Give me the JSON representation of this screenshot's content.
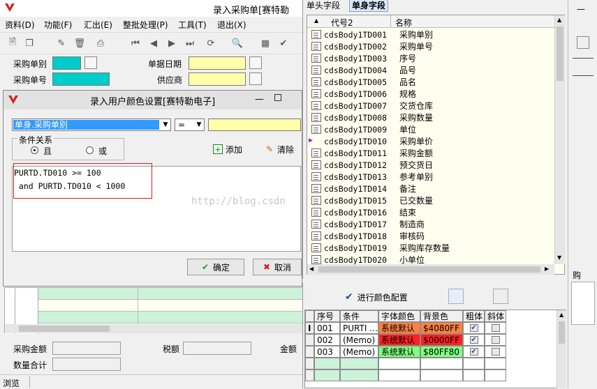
{
  "main_window": {
    "title": "录入采购单[赛特勒",
    "menu": [
      "资料(D)",
      "功能(F)",
      "汇出(E)",
      "整批处理(P)",
      "工具(T)",
      "退出(X)"
    ],
    "fields": {
      "po_type_label": "采购单别",
      "po_no_label": "采购单号",
      "doc_date_label": "单据日期",
      "supplier_label": "供应商",
      "po_amount_label": "采购金额",
      "tax_label": "税额",
      "amount_label": "金额",
      "qty_total_label": "数量合计"
    },
    "status": "浏览",
    "right_partial_label": "购"
  },
  "dialog": {
    "title": "录入用户颜色设置[赛特勒电子]",
    "field_select": "单身.采购单别",
    "operator": "=",
    "cond_group_label": "条件关系",
    "radio_and": "且",
    "radio_or": "或",
    "add_label": "添加",
    "clear_label": "清除",
    "expr_line1": "PURTD.TD010 >= 100",
    "expr_line2": " and PURTD.TD010 < 1000",
    "ok_label": "确定",
    "cancel_label": "取消",
    "watermark": "http://blog.csdn"
  },
  "field_panel": {
    "tab_header": "单头字段",
    "tab_body": "单身字段",
    "col_code": "代号2",
    "col_name": "名称",
    "rows": [
      {
        "code": "cdsBody1TD001",
        "name": "采购单别"
      },
      {
        "code": "cdsBody1TD002",
        "name": "采购单号"
      },
      {
        "code": "cdsBody1TD003",
        "name": "序号"
      },
      {
        "code": "cdsBody1TD004",
        "name": "品号"
      },
      {
        "code": "cdsBody1TD005",
        "name": "品名"
      },
      {
        "code": "cdsBody1TD006",
        "name": "规格"
      },
      {
        "code": "cdsBody1TD007",
        "name": "交货仓库"
      },
      {
        "code": "cdsBody1TD008",
        "name": "采购数量"
      },
      {
        "code": "cdsBody1TD009",
        "name": "单位"
      },
      {
        "code": "cdsBody1TD010",
        "name": "采购单价"
      },
      {
        "code": "cdsBody1TD011",
        "name": "采购金额"
      },
      {
        "code": "cdsBody1TD012",
        "name": "预交货日"
      },
      {
        "code": "cdsBody1TD013",
        "name": "参考单别"
      },
      {
        "code": "cdsBody1TD014",
        "name": "备注"
      },
      {
        "code": "cdsBody1TD015",
        "name": "已交数量"
      },
      {
        "code": "cdsBody1TD016",
        "name": "结束"
      },
      {
        "code": "cdsBody1TD017",
        "name": "制造商"
      },
      {
        "code": "cdsBody1TD018",
        "name": "审核码"
      },
      {
        "code": "cdsBody1TD019",
        "name": "采购库存数量"
      },
      {
        "code": "cdsBody1TD020",
        "name": "小单位"
      }
    ]
  },
  "color_config": {
    "button_label": "进行颜色配置",
    "headers": [
      "序号",
      "条件",
      "字体颜色",
      "背景色",
      "粗体",
      "斜体"
    ],
    "rows": [
      {
        "no": "001",
        "cond": "PURTI …",
        "font_color": "系统默认",
        "bg_color": "$4080FF",
        "font_bg": "#ff8040",
        "bg_bg": "#ff8040",
        "bold": "yes",
        "italic": "no"
      },
      {
        "no": "002",
        "cond": "(Memo)",
        "font_color": "系统默认",
        "bg_color": "$0000FF",
        "font_bg": "#ff2020",
        "bg_bg": "#ff2020",
        "bold": "yes",
        "italic": "no"
      },
      {
        "no": "003",
        "cond": "(Memo)",
        "font_color": "系统默认",
        "bg_color": "$80FF80",
        "font_bg": "#80ff80",
        "bg_bg": "#80ff80",
        "bold": "yes",
        "italic": "no"
      }
    ]
  },
  "colors": {
    "accent_blue": "#3399ff",
    "cyan": "#00cccc",
    "yellow": "#ffffaa",
    "grid_green": "#ccf2d9"
  }
}
